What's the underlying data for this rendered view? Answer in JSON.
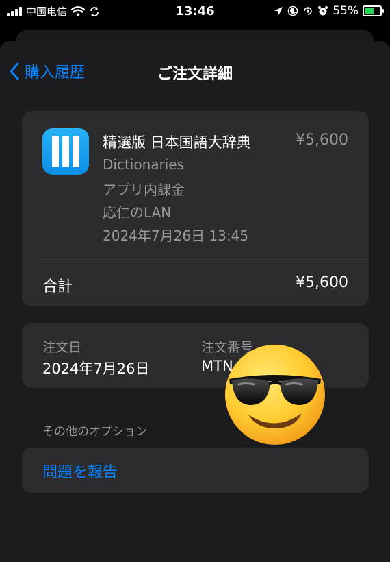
{
  "status_bar": {
    "carrier": "中国电信",
    "time": "13:46",
    "battery_percent": "55%",
    "battery_level": 0.55
  },
  "nav": {
    "back_label": "購入履歴",
    "title": "ご注文詳細"
  },
  "item": {
    "name": "精選版 日本国語大辞典",
    "price": "¥5,600",
    "category": "Dictionaries",
    "type": "アプリ内課金",
    "account": "応仁のLAN",
    "datetime": "2024年7月26日 13:45"
  },
  "total": {
    "label": "合計",
    "value": "¥5,600"
  },
  "order": {
    "date_label": "注文日",
    "date_value": "2024年7月26日",
    "number_label": "注文番号",
    "number_value": "MTN"
  },
  "options": {
    "section_label": "その他のオプション",
    "report_label": "問題を報告"
  },
  "colors": {
    "accent": "#0a84ff",
    "background": "#000000",
    "sheet": "#1c1c1e",
    "card": "#2c2c2e",
    "secondary_text": "#98989d"
  },
  "icons": [
    "cellular-signal-icon",
    "wifi-icon",
    "sync-icon",
    "location-arrow-icon",
    "do-not-disturb-icon",
    "orientation-lock-icon",
    "alarm-icon",
    "battery-icon",
    "chevron-left-icon",
    "dictionary-app-icon",
    "sunglasses-emoji-sticker"
  ]
}
